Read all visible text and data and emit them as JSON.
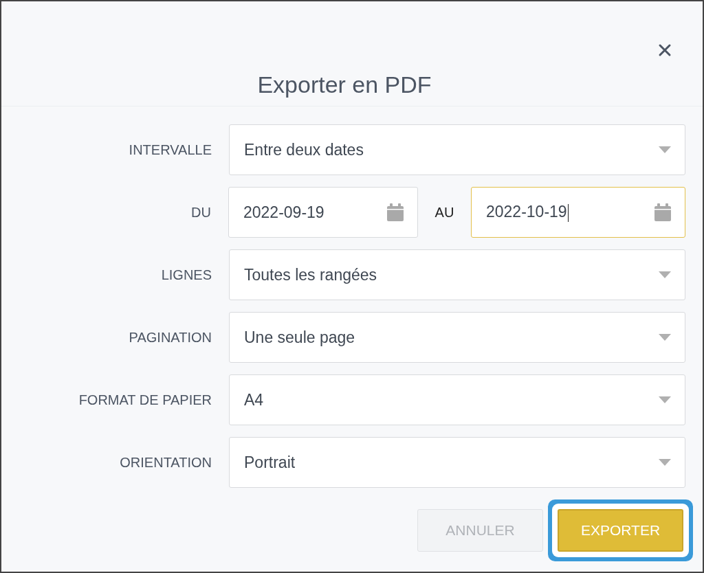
{
  "dialog": {
    "title": "Exporter en PDF"
  },
  "rows": [
    {
      "kind": "select",
      "label": "INTERVALLE",
      "value": "Entre deux dates"
    },
    {
      "kind": "dates",
      "label": "DU",
      "separator": "AU",
      "fields": [
        {
          "value": "2022-09-19",
          "focused": false
        },
        {
          "value": "2022-10-19",
          "focused": true
        }
      ]
    },
    {
      "kind": "select",
      "label": "LIGNES",
      "value": "Toutes les rangées"
    },
    {
      "kind": "select",
      "label": "PAGINATION",
      "value": "Une seule page"
    },
    {
      "kind": "select",
      "label": "FORMAT DE PAPIER",
      "value": "A4"
    },
    {
      "kind": "select",
      "label": "ORIENTATION",
      "value": "Portrait"
    }
  ],
  "buttons": [
    {
      "label": "ANNULER",
      "kind": "secondary",
      "disabled": true,
      "focused": false
    },
    {
      "label": "EXPORTER",
      "kind": "primary",
      "disabled": false,
      "focused": true
    }
  ]
}
